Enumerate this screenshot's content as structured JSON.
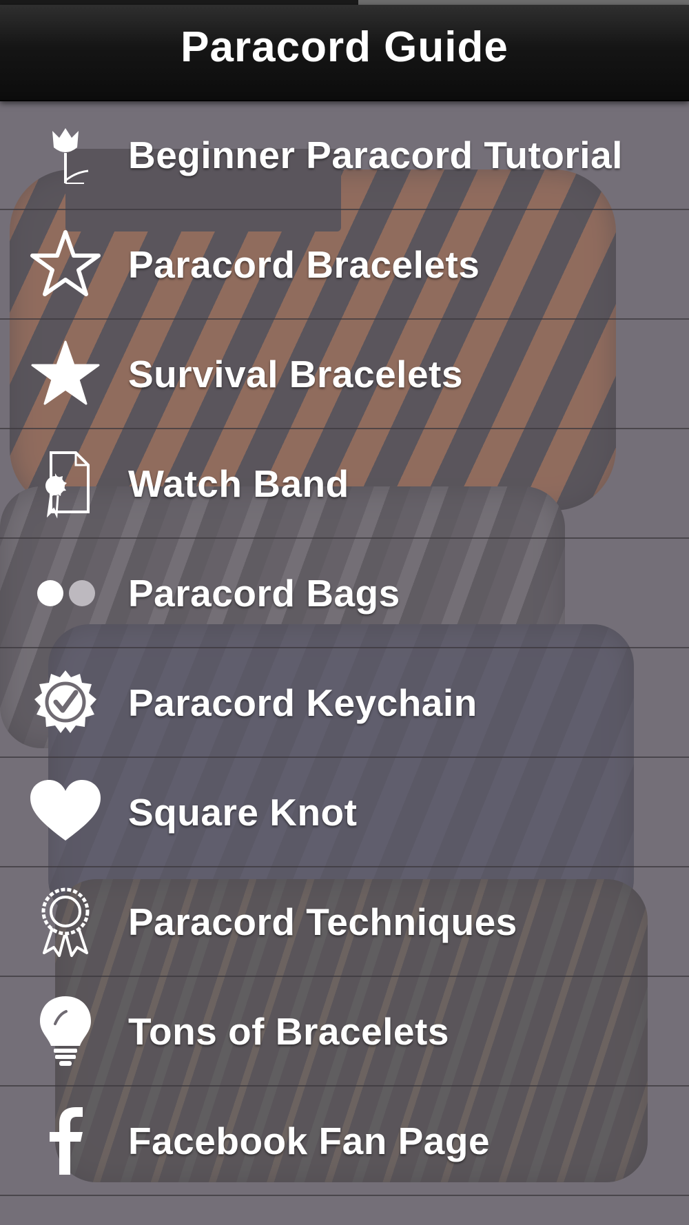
{
  "header": {
    "title": "Paracord Guide"
  },
  "menu": {
    "items": [
      {
        "label": "Beginner Paracord Tutorial",
        "icon": "flower-icon"
      },
      {
        "label": "Paracord Bracelets",
        "icon": "star-outline-icon"
      },
      {
        "label": "Survival Bracelets",
        "icon": "star-filled-icon"
      },
      {
        "label": "Watch Band",
        "icon": "certificate-document-icon"
      },
      {
        "label": "Paracord Bags",
        "icon": "two-dots-icon"
      },
      {
        "label": "Paracord Keychain",
        "icon": "badge-check-icon"
      },
      {
        "label": "Square Knot",
        "icon": "heart-icon"
      },
      {
        "label": "Paracord Techniques",
        "icon": "award-ribbon-icon"
      },
      {
        "label": "Tons of Bracelets",
        "icon": "lightbulb-icon"
      },
      {
        "label": "Facebook Fan Page",
        "icon": "facebook-icon"
      }
    ]
  },
  "colors": {
    "nav_bar": "#111111",
    "background_overlay": "#78727c",
    "text": "#ffffff"
  }
}
